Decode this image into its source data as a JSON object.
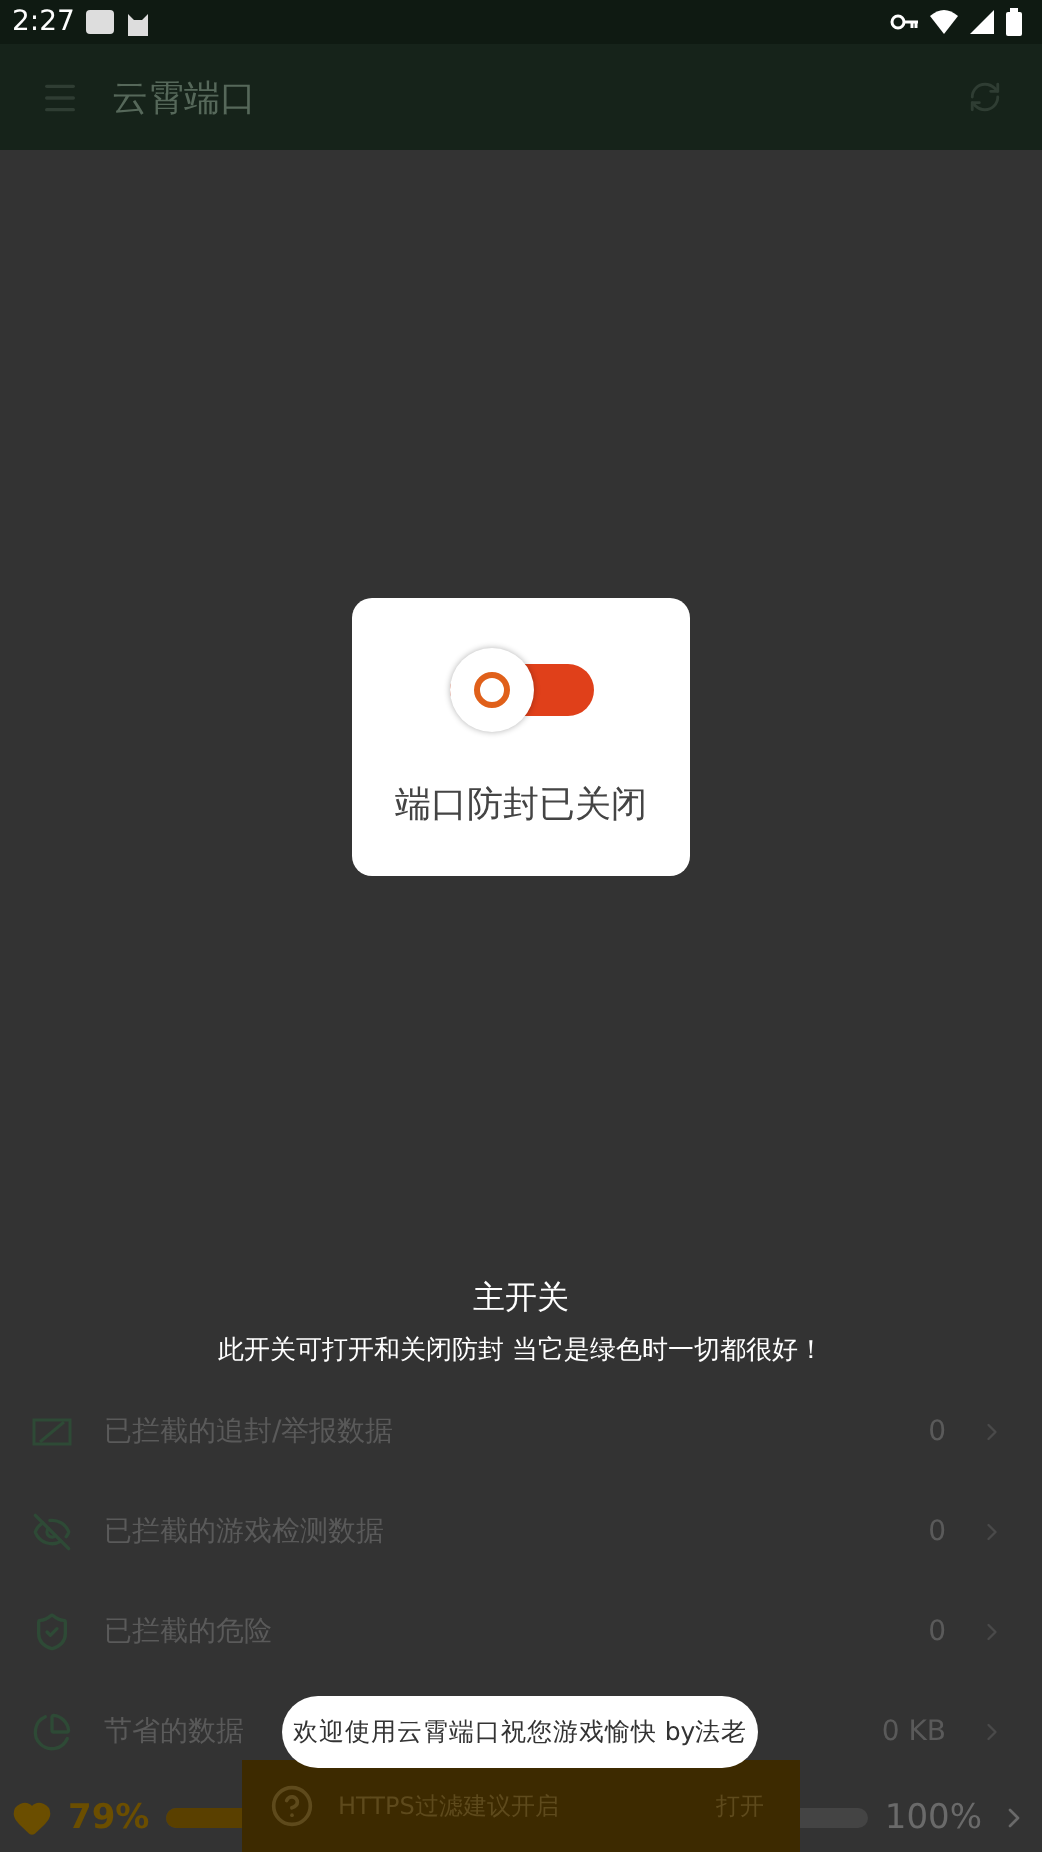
{
  "status_bar": {
    "time": "2:27"
  },
  "app_bar": {
    "title": "云霄端口"
  },
  "dialog": {
    "switch_on": false,
    "message": "端口防封已关闭"
  },
  "tip": {
    "title": "主开关",
    "text": "此开关可打开和关闭防封 当它是绿色时一切都很好！"
  },
  "rows": [
    {
      "label": "已拦截的追封/举报数据",
      "value": "0"
    },
    {
      "label": "已拦截的游戏检测数据",
      "value": "0"
    },
    {
      "label": "已拦截的危险",
      "value": "0"
    },
    {
      "label": "节省的数据",
      "value": "0 KB"
    }
  ],
  "score": {
    "value": "79%",
    "level": 0.79,
    "max": "100%"
  },
  "snackbar": {
    "text": "HTTPS过滤建议开启",
    "action": "打开"
  },
  "toast": {
    "text": "欢迎使用云霄端口祝您游戏愉快 by法老"
  }
}
